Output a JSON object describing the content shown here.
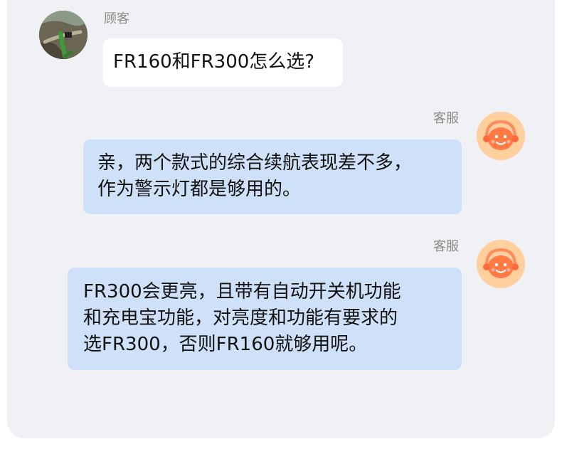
{
  "messages": [
    {
      "sender": "顾客",
      "role": "customer",
      "lines": [
        "FR160和FR300怎么选?"
      ]
    },
    {
      "sender": "客服",
      "role": "service",
      "lines": [
        "亲，两个款式的综合续航表现差不多，",
        "作为警示灯都是够用的。"
      ]
    },
    {
      "sender": "客服",
      "role": "service",
      "lines": [
        "FR300会更亮，且带有自动开关机功能",
        "和充电宝功能，对亮度和功能有要求的",
        "选FR300，否则FR160就够用呢。"
      ]
    }
  ],
  "colors": {
    "panel_bg": "#f0f1f5",
    "customer_bubble": "#ffffff",
    "service_bubble": "#cfe1f8",
    "service_avatar": "#ffcf9e",
    "service_avatar_face": "#ff7a45"
  },
  "icons": {
    "customer_avatar": "bicycle-photo-avatar",
    "service_avatar": "headset-smiley-icon"
  }
}
